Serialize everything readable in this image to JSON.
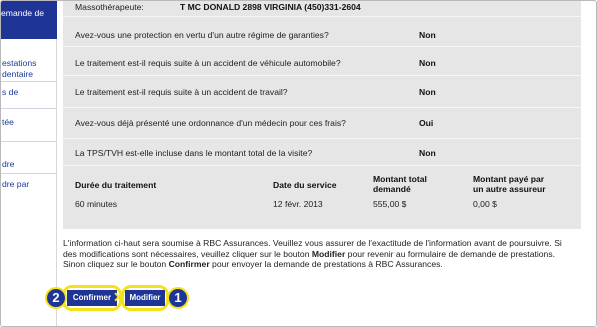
{
  "sidebar": {
    "header": "emande de",
    "items": [
      {
        "lines": [
          "estations",
          "dentaire"
        ]
      },
      {
        "lines": [
          "s de"
        ]
      },
      {
        "lines": [
          "tée"
        ]
      },
      {
        "lines": [
          "dre"
        ]
      },
      {
        "lines": [
          "dre par"
        ]
      }
    ]
  },
  "summary": {
    "massotherapist_label": "Massothérapeute:",
    "massotherapist_value": "T MC DONALD 2898 VIRGINIA (450)331-2604",
    "questions": [
      {
        "text": "Avez-vous une protection en vertu d'un autre régime de garanties?",
        "answer": "Non"
      },
      {
        "text": "Le traitement est-il requis suite à un accident de véhicule automobile?",
        "answer": "Non"
      },
      {
        "text": "Le traitement est-il requis suite à un accident de travail?",
        "answer": "Non"
      },
      {
        "text": "Avez-vous déjà présenté une ordonnance d'un médecin pour ces frais?",
        "answer": "Oui"
      },
      {
        "text": "La TPS/TVH est-elle incluse dans le montant total de la visite?",
        "answer": "Non"
      }
    ],
    "table": {
      "headers": {
        "duration": "Durée du traitement",
        "date": "Date du service",
        "amount_line1": "Montant total",
        "amount_line2": "demandé",
        "other_line1": "Montant payé par",
        "other_line2": "un autre assureur"
      },
      "row": {
        "duration": "60 minutes",
        "date": "12 févr. 2013",
        "amount": "555,00 $",
        "other": "0,00 $"
      }
    }
  },
  "info": {
    "p1": "L'information ci-haut sera soumise à RBC Assurances. Veuillez vous assurer de l'exactitude de l'information avant de poursuivre. Si des modifications sont nécessaires, veuillez cliquer sur le bouton ",
    "b1": "Modifier",
    "p2": " pour revenir au formulaire de demande de prestations. Sinon cliquez sur le bouton ",
    "b2": "Confirmer",
    "p3": " pour envoyer la demande de prestations à RBC Assurances."
  },
  "buttons": {
    "confirm": "Confirmer",
    "modify": "Modifier"
  },
  "callouts": {
    "confirm_number": "2",
    "modify_number": "1"
  },
  "colors": {
    "brand_blue": "#1f3596",
    "panel_grey": "#e6e6e6",
    "highlight_yellow": "#f4e21a"
  }
}
